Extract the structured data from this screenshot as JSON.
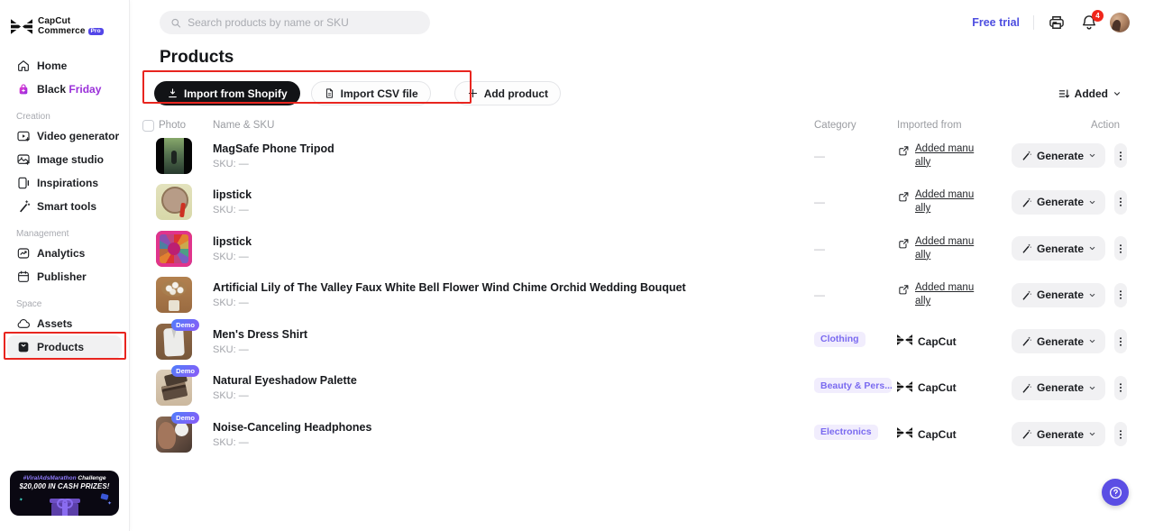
{
  "brand": {
    "line1": "CapCut",
    "line2": "Commerce",
    "badge": "Pro"
  },
  "topbar": {
    "search_placeholder": "Search products by name or SKU",
    "free_trial_label": "Free trial",
    "notification_count": "4"
  },
  "sidebar": {
    "primary": [
      {
        "label": "Home",
        "icon": "home-icon"
      },
      {
        "label": "Black Friday",
        "icon": "shopping-bag-icon",
        "two_tone": true
      }
    ],
    "sections": [
      {
        "label": "Creation",
        "items": [
          {
            "label": "Video generator",
            "icon": "video-generator-icon"
          },
          {
            "label": "Image studio",
            "icon": "image-studio-icon"
          },
          {
            "label": "Inspirations",
            "icon": "inspirations-icon"
          },
          {
            "label": "Smart tools",
            "icon": "smart-tools-icon"
          }
        ]
      },
      {
        "label": "Management",
        "items": [
          {
            "label": "Analytics",
            "icon": "analytics-icon"
          },
          {
            "label": "Publisher",
            "icon": "publisher-icon"
          }
        ]
      },
      {
        "label": "Space",
        "items": [
          {
            "label": "Assets",
            "icon": "assets-icon"
          },
          {
            "label": "Products",
            "icon": "products-icon",
            "selected": true,
            "annotated": true
          }
        ]
      }
    ]
  },
  "page": {
    "title": "Products"
  },
  "toolbar": {
    "buttons": [
      {
        "label": "Import from Shopify",
        "icon": "download-icon",
        "variant": "dark"
      },
      {
        "label": "Import CSV file",
        "icon": "csv-file-icon",
        "variant": "light"
      },
      {
        "label": "Add product",
        "icon": "plus-icon",
        "variant": "light",
        "gap_big": true
      }
    ],
    "sort_label": "Added",
    "sort_icon": "sort-icon"
  },
  "table": {
    "headers": {
      "photo": "Photo",
      "name": "Name & SKU",
      "category": "Category",
      "imported": "Imported from",
      "action": "Action"
    },
    "generate_label": "Generate",
    "demo_badge_label": "Demo",
    "empty_value": "—"
  },
  "rows": [
    {
      "name": "MagSafe Phone Tripod",
      "sku": "SKU: —",
      "category": null,
      "imported": {
        "type": "manual",
        "label": "Added manually"
      },
      "demo": false,
      "photo": "magsafe-phone-tripod-video-thumb"
    },
    {
      "name": "lipstick",
      "sku": "SKU: —",
      "category": null,
      "imported": {
        "type": "manual",
        "label": "Added manually"
      },
      "demo": false,
      "photo": "lipstick-mirror-thumb"
    },
    {
      "name": "lipstick",
      "sku": "SKU: —",
      "category": null,
      "imported": {
        "type": "manual",
        "label": "Added manually"
      },
      "demo": false,
      "photo": "lipstick-color-wheel-thumb"
    },
    {
      "name": "Artificial Lily of The Valley Faux White Bell Flower Wind Chime Orchid Wedding Bouquet",
      "sku": "SKU: —",
      "category": null,
      "imported": {
        "type": "manual",
        "label": "Added manually"
      },
      "demo": false,
      "photo": "white-flower-bouquet-thumb"
    },
    {
      "name": "Men's Dress Shirt",
      "sku": "SKU: —",
      "category": "Clothing",
      "imported": {
        "type": "capcut",
        "label": "CapCut"
      },
      "demo": true,
      "photo": "dress-shirt-thumb"
    },
    {
      "name": "Natural Eyeshadow Palette",
      "sku": "SKU: —",
      "category": "Beauty & Pers...",
      "imported": {
        "type": "capcut",
        "label": "CapCut"
      },
      "demo": true,
      "photo": "eyeshadow-palette-thumb"
    },
    {
      "name": "Noise-Canceling Headphones",
      "sku": "SKU: —",
      "category": "Electronics",
      "imported": {
        "type": "capcut",
        "label": "CapCut"
      },
      "demo": true,
      "photo": "headphones-thumb"
    }
  ],
  "banner": {
    "hashtag": "#ViralAdsMarathon",
    "challenge": "Challenge",
    "prize": "$20,000 IN CASH PRIZES!"
  },
  "colors": {
    "accent_purple": "#4d4ee0",
    "annotation_red": "#e8251f",
    "category_badge_bg": "#f1edfd",
    "category_badge_text": "#7a6af0",
    "demo_gradient_start": "#4f7dfb",
    "demo_gradient_end": "#8b5bf6",
    "friday_purple": "#9a30d9"
  }
}
